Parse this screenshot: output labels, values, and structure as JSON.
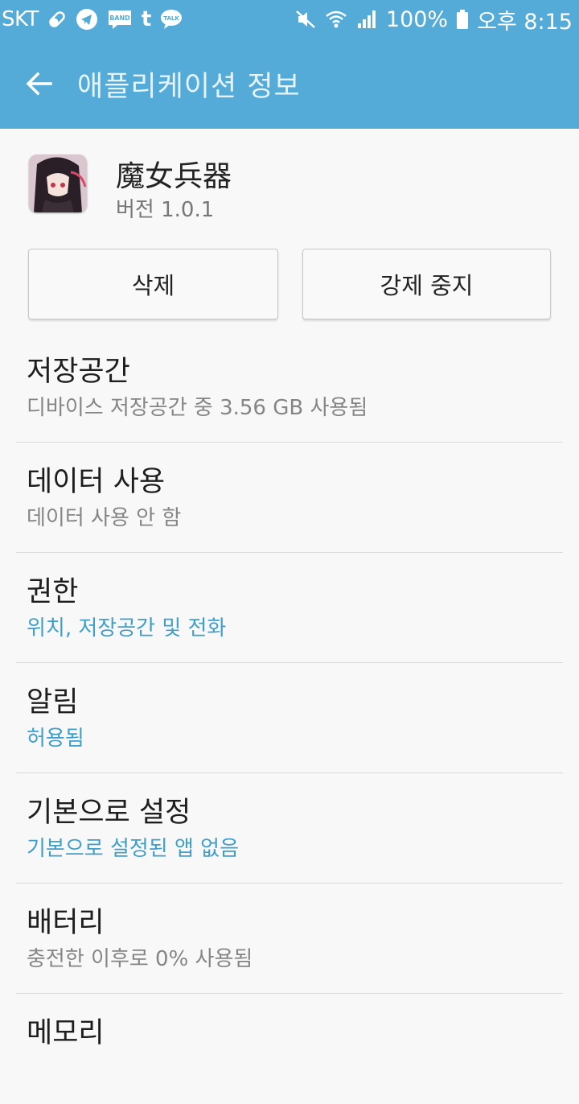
{
  "status_bar": {
    "carrier": "SKT",
    "battery_percent": "100%",
    "time": "오후 8:15",
    "band_badge": "BAND",
    "tumblr_badge": "t",
    "talk_badge": "TALK"
  },
  "app_bar": {
    "title": "애플리케이션 정보"
  },
  "app": {
    "name": "魔女兵器",
    "version": "버전 1.0.1"
  },
  "buttons": {
    "uninstall": "삭제",
    "force_stop": "강제 중지"
  },
  "settings": [
    {
      "title": "저장공간",
      "subtitle": "디바이스 저장공간 중 3.56 GB 사용됨"
    },
    {
      "title": "데이터 사용",
      "subtitle": "데이터 사용 안 함"
    },
    {
      "title": "권한",
      "subtitle": "위치, 저장공간 및 전화"
    },
    {
      "title": "알림",
      "subtitle": "허용됨"
    },
    {
      "title": "기본으로 설정",
      "subtitle": "기본으로 설정된 앱 없음"
    },
    {
      "title": "배터리",
      "subtitle": "충전한 이후로 0% 사용됨"
    },
    {
      "title": "메모리",
      "subtitle": ""
    }
  ],
  "colors": {
    "header": "#54abd8",
    "accent_text": "#3f9fca",
    "background": "#f8f8f8"
  }
}
